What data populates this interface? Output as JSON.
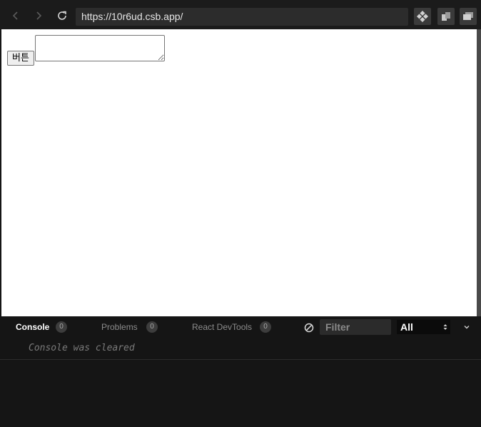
{
  "browser": {
    "url": "https://10r6ud.csb.app/"
  },
  "preview": {
    "button_label": "버튼",
    "textarea_value": ""
  },
  "devtools": {
    "tabs": [
      {
        "label": "Console",
        "count": "0",
        "active": true
      },
      {
        "label": "Problems",
        "count": "0",
        "active": false
      },
      {
        "label": "React DevTools",
        "count": "0",
        "active": false
      }
    ],
    "filter_placeholder": "Filter",
    "level_value": "All",
    "console_message": "Console was cleared"
  },
  "icons": {
    "back": "chevron-left-icon",
    "forward": "chevron-right-icon",
    "reload": "reload-icon",
    "codesandbox": "codesandbox-logo-icon",
    "open_new_window": "open-window-icon",
    "open_devtools": "layout-panels-icon",
    "clear_console": "clear-console-icon",
    "collapse": "chevron-down-icon"
  },
  "colors": {
    "toolbar_bg": "#1b1b1b",
    "url_bar_bg": "#2c2c2c",
    "devtools_bg": "#151515",
    "preview_bg": "#ffffff"
  }
}
